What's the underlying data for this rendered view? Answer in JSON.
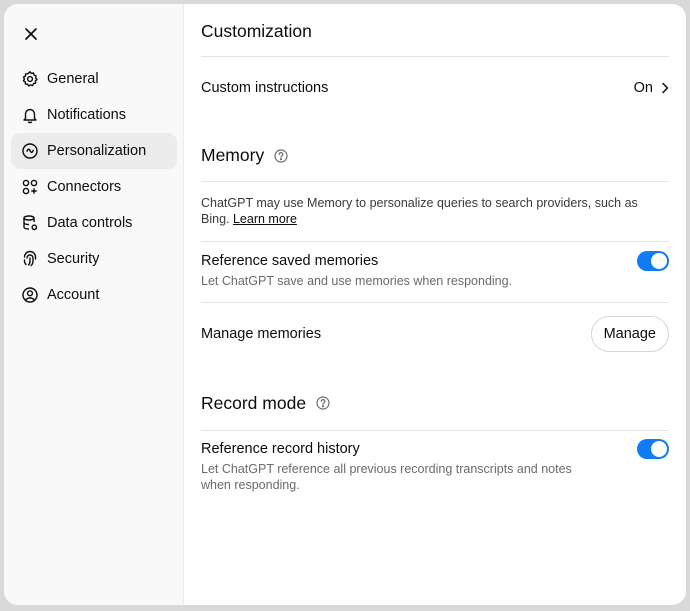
{
  "sidebar": {
    "items": [
      {
        "label": "General",
        "icon": "gear-icon"
      },
      {
        "label": "Notifications",
        "icon": "bell-icon"
      },
      {
        "label": "Personalization",
        "icon": "personalization-icon",
        "active": true
      },
      {
        "label": "Connectors",
        "icon": "connectors-icon"
      },
      {
        "label": "Data controls",
        "icon": "database-icon"
      },
      {
        "label": "Security",
        "icon": "fingerprint-icon"
      },
      {
        "label": "Account",
        "icon": "user-circle-icon"
      }
    ]
  },
  "main": {
    "title": "Customization",
    "custom_instructions": {
      "label": "Custom instructions",
      "value": "On"
    },
    "memory": {
      "title": "Memory",
      "description": "ChatGPT may use Memory to personalize queries to search providers, such as Bing.",
      "learn_more": "Learn more",
      "reference_saved": {
        "title": "Reference saved memories",
        "subtitle": "Let ChatGPT save and use memories when responding.",
        "enabled": true
      },
      "manage": {
        "label": "Manage memories",
        "button": "Manage"
      }
    },
    "record_mode": {
      "title": "Record mode",
      "reference_history": {
        "title": "Reference record history",
        "subtitle": "Let ChatGPT reference all previous recording transcripts and notes when responding.",
        "enabled": true
      }
    }
  },
  "colors": {
    "toggle_on": "#0f7bf4",
    "sidebar_bg": "#f9f9f9",
    "active_item_bg": "#ececec"
  }
}
